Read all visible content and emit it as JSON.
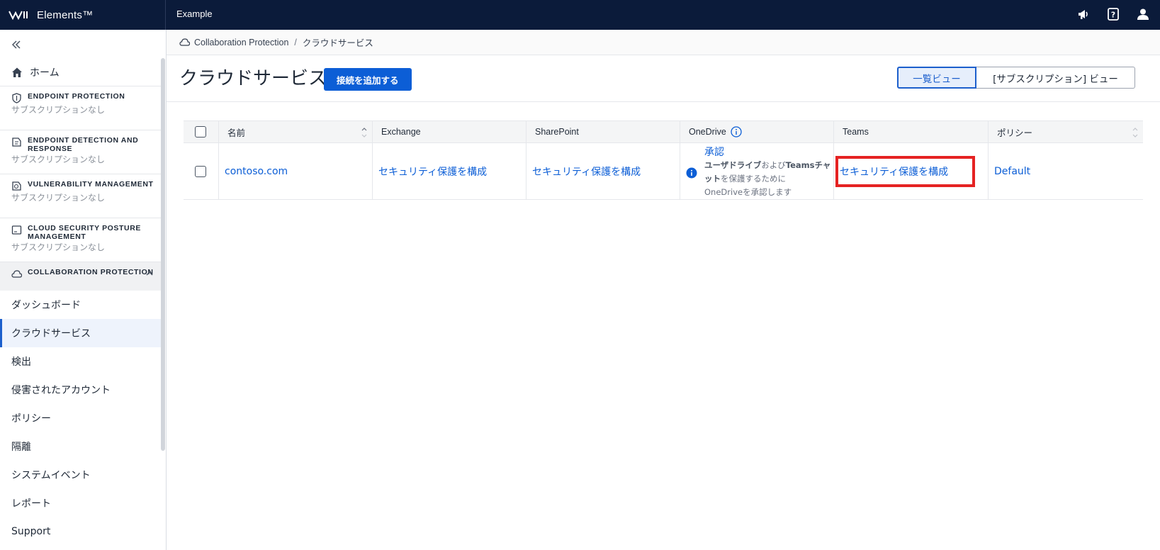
{
  "topbar": {
    "brand": "Elements™",
    "org": "Example",
    "icons": [
      "megaphone-icon",
      "help-icon",
      "user-icon"
    ]
  },
  "sidebar": {
    "home": "ホーム",
    "sections": [
      {
        "title": "ENDPOINT PROTECTION",
        "subtitle": "サブスクリプションなし",
        "icon": "shield-icon"
      },
      {
        "title": "ENDPOINT DETECTION AND RESPONSE",
        "subtitle": "サブスクリプションなし",
        "icon": "detection-icon"
      },
      {
        "title": "VULNERABILITY MANAGEMENT",
        "subtitle": "サブスクリプションなし",
        "icon": "vulnerability-icon"
      },
      {
        "title": "CLOUD SECURITY POSTURE MANAGEMENT",
        "subtitle": "サブスクリプションなし",
        "icon": "cloud-posture-icon"
      }
    ],
    "open_section": {
      "title": "COLLABORATION PROTECTION",
      "icon": "cloud-icon"
    },
    "items": [
      "ダッシュボード",
      "クラウドサービス",
      "検出",
      "侵害されたアカウント",
      "ポリシー",
      "隔離",
      "システムイベント",
      "レポート",
      "Support"
    ],
    "active_item": "クラウドサービス"
  },
  "breadcrumb": {
    "root": "Collaboration Protection",
    "separator": "/",
    "current": "クラウドサービス"
  },
  "header": {
    "title": "クラウドサービス",
    "add_button": "接続を追加する",
    "view_list": "一覧ビュー",
    "view_subscription": "[サブスクリプション] ビュー"
  },
  "table": {
    "columns": [
      "名前",
      "Exchange",
      "SharePoint",
      "OneDrive",
      "Teams",
      "ポリシー"
    ],
    "rows": [
      {
        "name": "contoso.com",
        "exchange": "セキュリティ保護を構成",
        "sharepoint": "セキュリティ保護を構成",
        "onedrive_link": "承認",
        "onedrive_desc_bold1": "ユーザドライブ",
        "onedrive_desc_1": "および",
        "onedrive_desc_bold2": "Teamsチャット",
        "onedrive_desc_2": "を保護するために",
        "onedrive_desc_3": "OneDriveを承認します",
        "teams": "セキュリティ保護を構成",
        "policy": "Default"
      }
    ]
  },
  "colors": {
    "topbar": "#0b1b3a",
    "accent": "#0c5ed6",
    "highlight": "#e52222"
  }
}
